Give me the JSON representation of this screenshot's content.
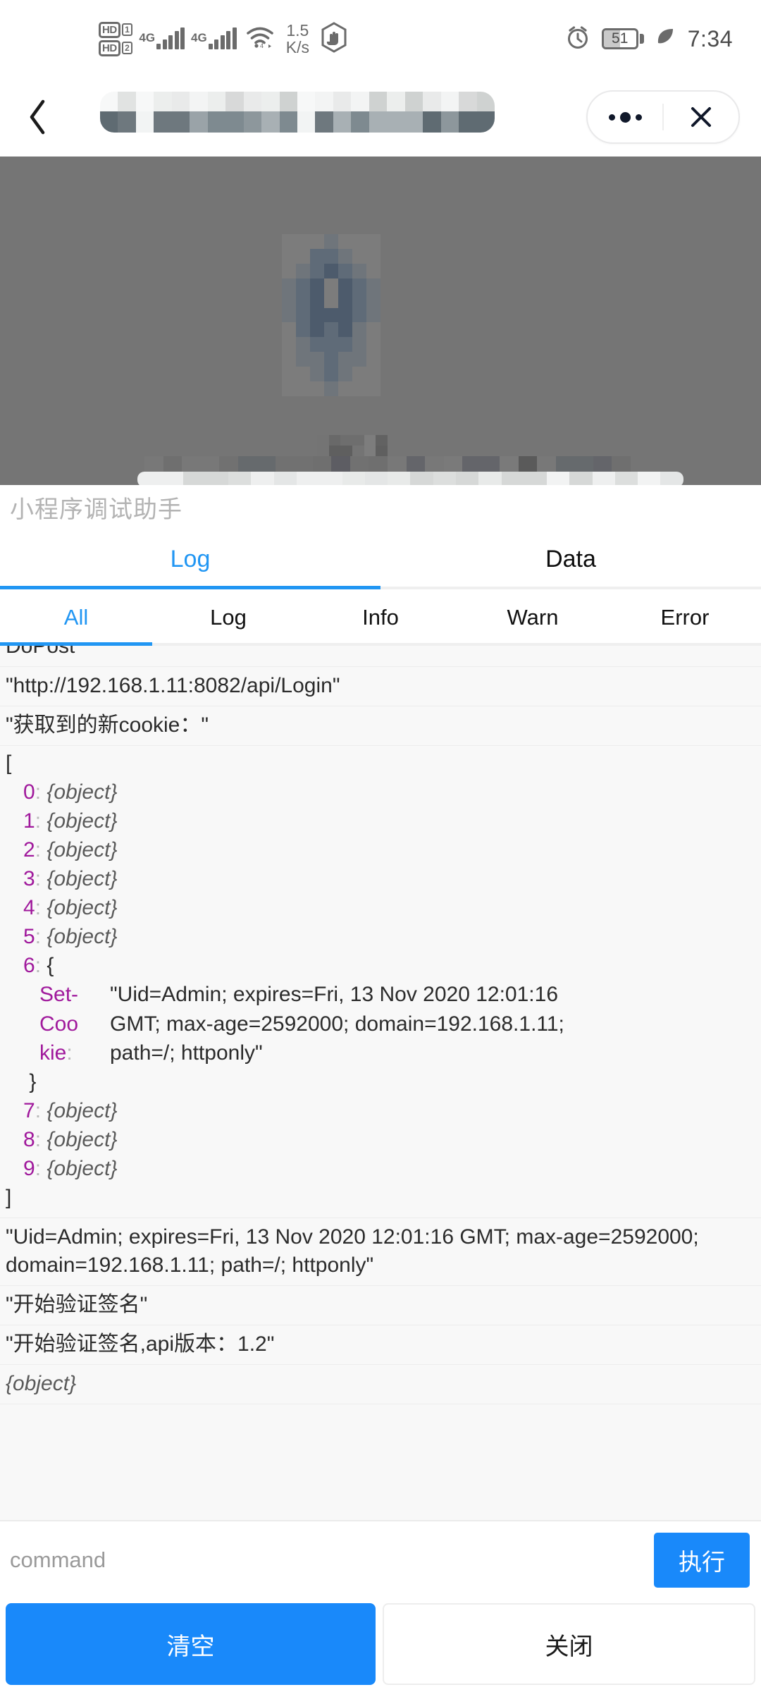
{
  "status_bar": {
    "volte_1": "HD",
    "volte_1_sim": "1",
    "volte_2": "HD",
    "volte_2_sim": "2",
    "network_1": "4G",
    "network_2": "4G",
    "net_speed_value": "1.5",
    "net_speed_unit": "K/s",
    "battery_percent": "51",
    "time": "7:34",
    "icons": [
      "volte-hd-icon",
      "signal-bars-icon",
      "wifi-icon",
      "do-not-disturb-icon",
      "alarm-clock-icon",
      "battery-icon",
      "power-saving-leaf-icon"
    ]
  },
  "nav": {
    "back_icon": "chevron-left-icon",
    "title_redacted": "",
    "more_icon": "more-options-icon",
    "close_icon": "close-icon"
  },
  "app": {
    "title": "小程序调试助手"
  },
  "main_tabs": [
    {
      "label": "Log",
      "active": true
    },
    {
      "label": "Data",
      "active": false
    }
  ],
  "sub_tabs": [
    {
      "label": "All",
      "active": true
    },
    {
      "label": "Log",
      "active": false
    },
    {
      "label": "Info",
      "active": false
    },
    {
      "label": "Warn",
      "active": false
    },
    {
      "label": "Error",
      "active": false
    }
  ],
  "log_entries": {
    "row_0_clipped": "DoPost",
    "row_1": "\"http://192.168.1.11:8082/api/Login\"",
    "row_2": "\"获取到的新cookie：\"",
    "array_open": "[",
    "array_close": "]",
    "array_items": [
      {
        "index": "0",
        "value": "{object}"
      },
      {
        "index": "1",
        "value": "{object}"
      },
      {
        "index": "2",
        "value": "{object}"
      },
      {
        "index": "3",
        "value": "{object}"
      },
      {
        "index": "4",
        "value": "{object}"
      },
      {
        "index": "5",
        "value": "{object}"
      }
    ],
    "expanded_index": "6",
    "expanded_open": "{",
    "expanded_close": "}",
    "expanded_key_line1": "Set-",
    "expanded_key_line2": "Coo",
    "expanded_key_line3": "kie",
    "expanded_value_line1": "\"Uid=Admin; expires=Fri, 13 Nov 2020 12:01:16",
    "expanded_value_line2": "GMT; max-age=2592000; domain=192.168.1.11;",
    "expanded_value_line3": "path=/; httponly\"",
    "array_items_tail": [
      {
        "index": "7",
        "value": "{object}"
      },
      {
        "index": "8",
        "value": "{object}"
      },
      {
        "index": "9",
        "value": "{object}"
      }
    ],
    "row_cookie_string": "\"Uid=Admin; expires=Fri, 13 Nov 2020 12:01:16 GMT; max-age=2592000; domain=192.168.1.11; path=/; httponly\"",
    "row_sign_start": "\"开始验证签名\"",
    "row_sign_version": "\"开始验证签名,api版本：1.2\"",
    "row_last_clipped": "{object}"
  },
  "command_bar": {
    "placeholder": "command",
    "value": "",
    "exec_label": "执行"
  },
  "bottom_actions": {
    "clear_label": "清空",
    "close_label": "关闭"
  },
  "colors": {
    "accent_blue": "#1989fa",
    "tab_blue": "#2196f3",
    "key_purple": "#a0199c",
    "preview_gray": "#757575",
    "log_bg": "#f8f8f8"
  }
}
